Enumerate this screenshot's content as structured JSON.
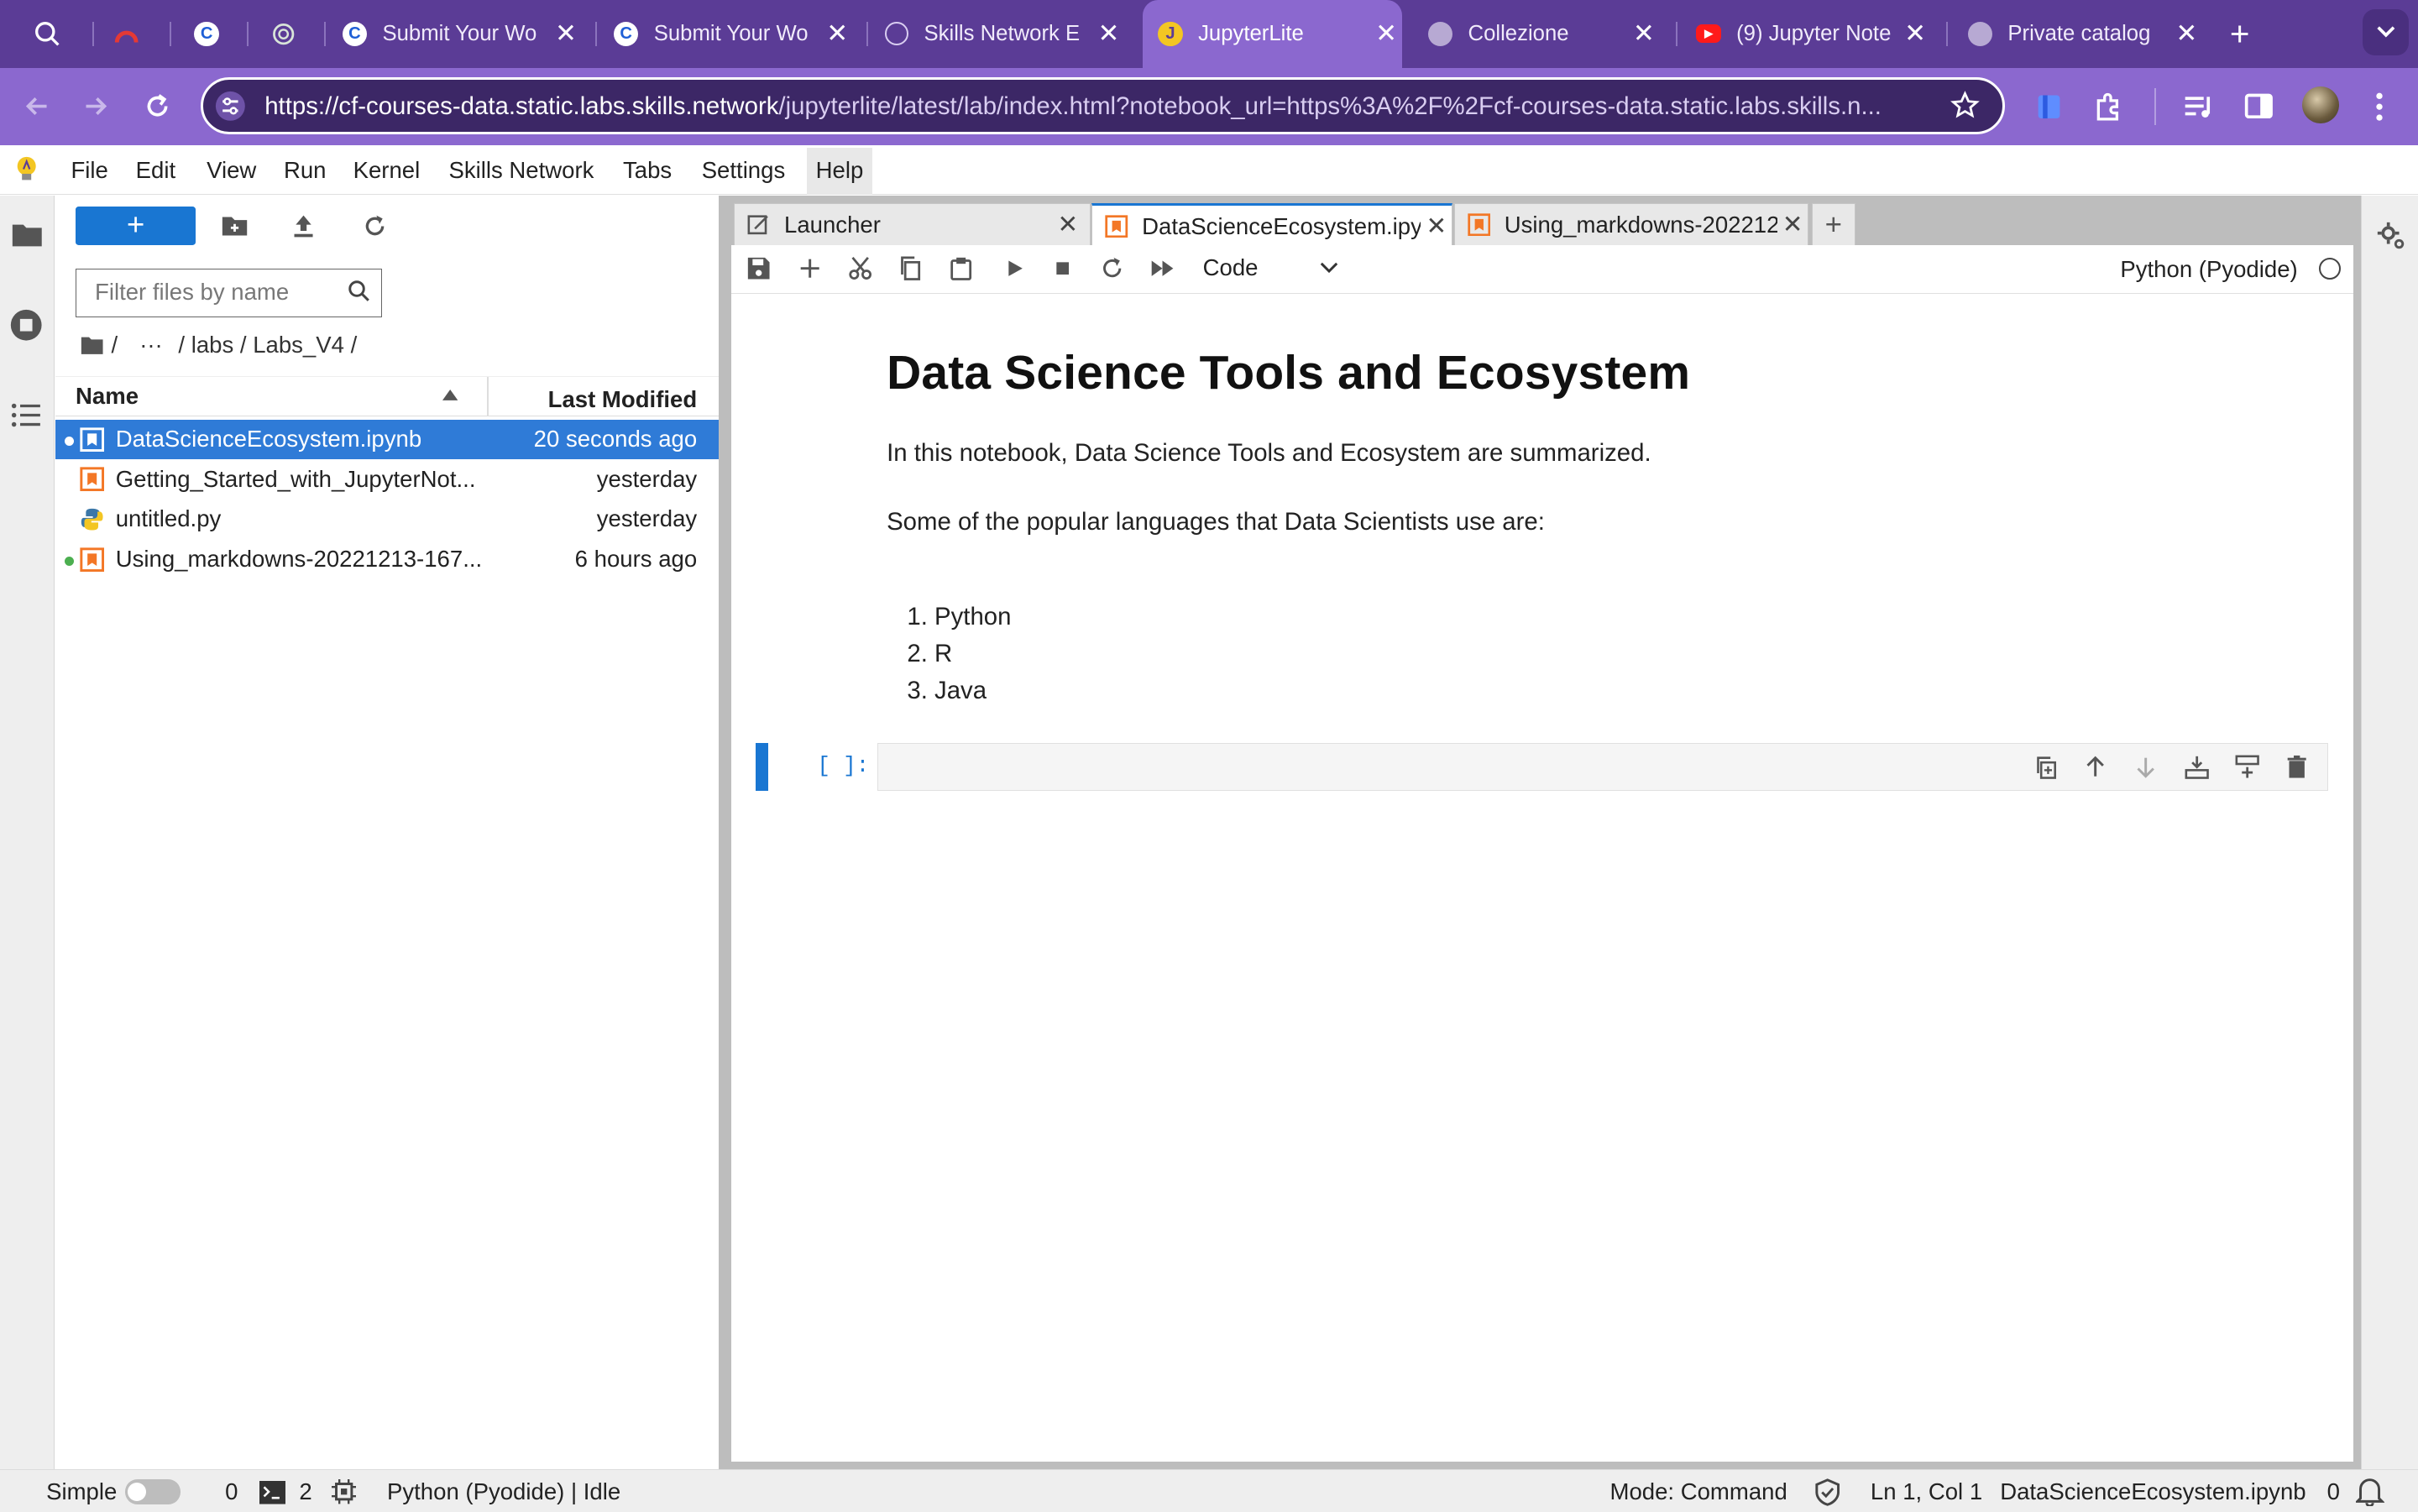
{
  "browser": {
    "tabs": [
      {
        "title": "",
        "favicon": "search-icon",
        "active": false
      },
      {
        "title": "",
        "favicon": "red-arc-icon",
        "active": false
      },
      {
        "title": "",
        "favicon": "c-logo-icon",
        "active": false
      },
      {
        "title": "",
        "favicon": "openai-icon",
        "active": false
      },
      {
        "title": "Submit Your Wo",
        "favicon": "c-logo-icon",
        "active": false
      },
      {
        "title": "Submit Your Wo",
        "favicon": "c-logo-icon",
        "active": false
      },
      {
        "title": "Skills Network E",
        "favicon": "skills-network-icon",
        "active": false
      },
      {
        "title": "JupyterLite",
        "favicon": "jupyterlite-icon",
        "active": true
      },
      {
        "title": "Collezione",
        "favicon": "globe-icon",
        "active": false
      },
      {
        "title": "(9) Jupyter Note",
        "favicon": "youtube-icon",
        "active": false
      },
      {
        "title": "Private catalog",
        "favicon": "globe-icon",
        "active": false
      }
    ],
    "url_host": "https://cf-courses-data.static.labs.skills.network",
    "url_path": "/jupyterlite/latest/lab/index.html?notebook_url=https%3A%2F%2Fcf-courses-data.static.labs.skills.n...",
    "colors": {
      "tabstrip": "#5b3c96",
      "toolbar": "#8b68cf"
    }
  },
  "menubar": {
    "items": [
      "File",
      "Edit",
      "View",
      "Run",
      "Kernel",
      "Skills Network",
      "Tabs",
      "Settings",
      "Help"
    ],
    "active": "Help"
  },
  "filebrowser": {
    "new_label": "+",
    "filter_placeholder": "Filter files by name",
    "breadcrumb": [
      "/",
      "···",
      "/ labs / Labs_V4 /"
    ],
    "columns": {
      "name": "Name",
      "modified": "Last Modified"
    },
    "files": [
      {
        "name": "DataScienceEcosystem.ipynb",
        "modified": "20 seconds ago",
        "type": "notebook",
        "selected": true,
        "running": true
      },
      {
        "name": "Getting_Started_with_JupyterNot...",
        "modified": "yesterday",
        "type": "notebook",
        "selected": false,
        "running": false
      },
      {
        "name": "untitled.py",
        "modified": "yesterday",
        "type": "python",
        "selected": false,
        "running": false
      },
      {
        "name": "Using_markdowns-20221213-167...",
        "modified": "6 hours ago",
        "type": "notebook",
        "selected": false,
        "running": true
      }
    ]
  },
  "doc_tabs": [
    {
      "label": "Launcher",
      "icon": "launcher-icon",
      "active": false
    },
    {
      "label": "DataScienceEcosystem.ipy",
      "icon": "notebook-icon",
      "active": true
    },
    {
      "label": "Using_markdowns-202212",
      "icon": "notebook-icon",
      "active": false
    }
  ],
  "notebook": {
    "cell_type": "Code",
    "kernel": "Python (Pyodide)",
    "title": "Data Science Tools and Ecosystem",
    "intro": "In this notebook, Data Science Tools and Ecosystem are summarized.",
    "languages_intro": "Some of the popular languages that Data Scientists use are:",
    "languages": [
      "Python",
      "R",
      "Java"
    ],
    "code_prompt": "[ ]:"
  },
  "statusbar": {
    "mode_label": "Simple",
    "terminals": "0",
    "kernels": "2",
    "kernel_status": "Python (Pyodide) | Idle",
    "mode": "Mode: Command",
    "cursor": "Ln 1, Col 1",
    "filename": "DataScienceEcosystem.ipynb",
    "notifications": "0"
  }
}
